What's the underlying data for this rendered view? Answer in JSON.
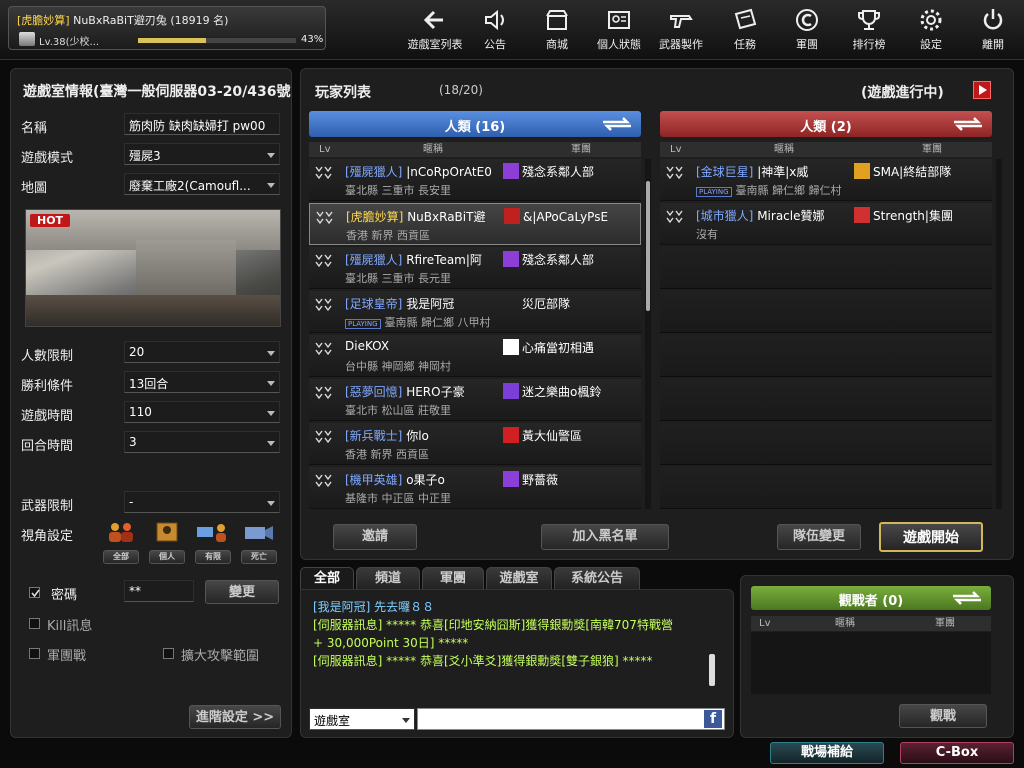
{
  "profile": {
    "tag": "[虎膽妙算]",
    "name": "NuBxRaBiT避刃兔",
    "count": "(18919 名)",
    "level": "Lv.38(少校...",
    "exp_pct": "43%",
    "exp_value": 0.43
  },
  "nav": [
    {
      "label": "遊戲室列表",
      "icon": "back-arrow-icon"
    },
    {
      "label": "公告",
      "icon": "speaker-icon"
    },
    {
      "label": "商城",
      "icon": "shop-icon"
    },
    {
      "label": "個人狀態",
      "icon": "id-card-icon"
    },
    {
      "label": "武器製作",
      "icon": "gun-icon"
    },
    {
      "label": "任務",
      "icon": "mission-icon"
    },
    {
      "label": "軍團",
      "icon": "clan-icon"
    },
    {
      "label": "排行榜",
      "icon": "trophy-icon"
    },
    {
      "label": "設定",
      "icon": "gear-icon"
    },
    {
      "label": "離開",
      "icon": "power-icon"
    }
  ],
  "room": {
    "title": "遊戲室情報(臺灣一般伺服器03-20/436號...",
    "name_label": "名稱",
    "name_value": "筋肉防 缺肉缺婦打 pw00",
    "mode_label": "遊戲模式",
    "mode_value": "殭屍3",
    "map_label": "地圖",
    "map_value": "廢棄工廠2(Camoufl...",
    "hot": "HOT",
    "limit_label": "人數限制",
    "limit_value": "20",
    "win_label": "勝利條件",
    "win_value": "13回合",
    "time_label": "遊戲時間",
    "time_value": "110",
    "round_label": "回合時間",
    "round_value": "3",
    "weapon_label": "武器限制",
    "weapon_value": "-",
    "view_label": "視角設定",
    "views": [
      "全部",
      "個人",
      "有限",
      "死亡"
    ],
    "pw_label": "密碼",
    "pw_value": "**",
    "change": "變更",
    "kill_label": "Kill訊息",
    "team_label": "軍團戰",
    "expand_label": "擴大攻擊範圍",
    "advanced": "進階設定 >>"
  },
  "players": {
    "title": "玩家列表",
    "count": "(18/20)",
    "status": "(遊戲進行中)",
    "col_lv": "Lv",
    "col_nick": "暱稱",
    "col_clan": "軍團",
    "human_a": "人類 (16)",
    "human_b": "人類 (2)",
    "team_a": [
      {
        "tag": "[殭屍獵人]",
        "tagc": "b",
        "nick": "|nCoRpOrAtE0",
        "loc": "臺北縣 三重市 長安里",
        "clan": "殘念系鄰人部",
        "ci": "#8b3fd6",
        "playing": false
      },
      {
        "tag": "[虎膽妙算]",
        "tagc": "y",
        "nick": "NuBxRaBiT避",
        "loc": "香港 新界 西貢區",
        "clan": "&|APoCaLyPsE",
        "ci": "#c02020",
        "playing": false,
        "me": true
      },
      {
        "tag": "[殭屍獵人]",
        "tagc": "b",
        "nick": "RfireTeam|阿",
        "loc": "臺北縣 三重市 長元里",
        "clan": "殘念系鄰人部",
        "ci": "#8b3fd6",
        "playing": false
      },
      {
        "tag": "[足球皇帝]",
        "tagc": "b",
        "nick": "我是阿冠",
        "loc": "臺南縣 歸仁鄉 八甲村",
        "clan": "災厄部隊",
        "ci": "",
        "playing": true
      },
      {
        "tag": "",
        "tagc": "b",
        "nick": "DieKOX",
        "loc": "台中縣 神岡鄉 神岡村",
        "clan": "心痛當初相遇",
        "ci": "#ffffff",
        "playing": false
      },
      {
        "tag": "[惡夢回憶]",
        "tagc": "b",
        "nick": "HERO子豪",
        "loc": "臺北市 松山區 莊敬里",
        "clan": "迷之樂曲o楓鈴",
        "ci": "#7a3fd6",
        "playing": false
      },
      {
        "tag": "[新兵戰士]",
        "tagc": "b",
        "nick": "你lo",
        "loc": "香港 新界 西貢區",
        "clan": "黃大仙警區",
        "ci": "#d02020",
        "playing": false
      },
      {
        "tag": "[機甲英雄]",
        "tagc": "b",
        "nick": "o果子o",
        "loc": "基隆市 中正區 中正里",
        "clan": "野薔薇",
        "ci": "#8b3fd6",
        "playing": false
      }
    ],
    "team_b": [
      {
        "tag": "[金球巨星]",
        "tagc": "b",
        "nick": "|神準|x威",
        "loc": "臺南縣 歸仁鄉 歸仁村",
        "clan": "SMA|終結部隊",
        "ci": "#e0a020",
        "playing": true
      },
      {
        "tag": "[城市獵人]",
        "tagc": "b",
        "nick": "Miracle贊娜",
        "loc": "沒有",
        "clan": "Strength|集團",
        "ci": "#d03030",
        "playing": false
      }
    ],
    "playing_badge": "PLAYING",
    "invite": "邀請",
    "blacklist": "加入黑名單",
    "team_change": "隊伍變更",
    "start": "遊戲開始"
  },
  "chat": {
    "tabs": [
      "全部",
      "頻道",
      "軍團",
      "遊戲室",
      "系統公告"
    ],
    "messages": [
      "[我是阿冠] 先去囉８８",
      "[伺服器訊息] ***** 恭喜[印地安納囧斯]獲得銀勳獎[南韓707特戰營",
      "+ 30,000Point 30日] *****",
      "[伺服器訊息] ***** 恭喜[爻小準爻]獲得銀勳獎[雙子銀狼] *****"
    ],
    "channel": "遊戲室",
    "input": ""
  },
  "spectator": {
    "title": "觀戰者 (0)",
    "col_lv": "Lv",
    "col_nick": "暱稱",
    "col_clan": "軍團",
    "watch": "觀戰"
  },
  "footer": {
    "supply": "戰場補給",
    "cbox": "C-Box"
  },
  "colors": {
    "blue_header": "#3b6fc4",
    "red_header": "#a83232",
    "green_header": "#5f8f2e",
    "chat_green": "#c4ff5a"
  }
}
